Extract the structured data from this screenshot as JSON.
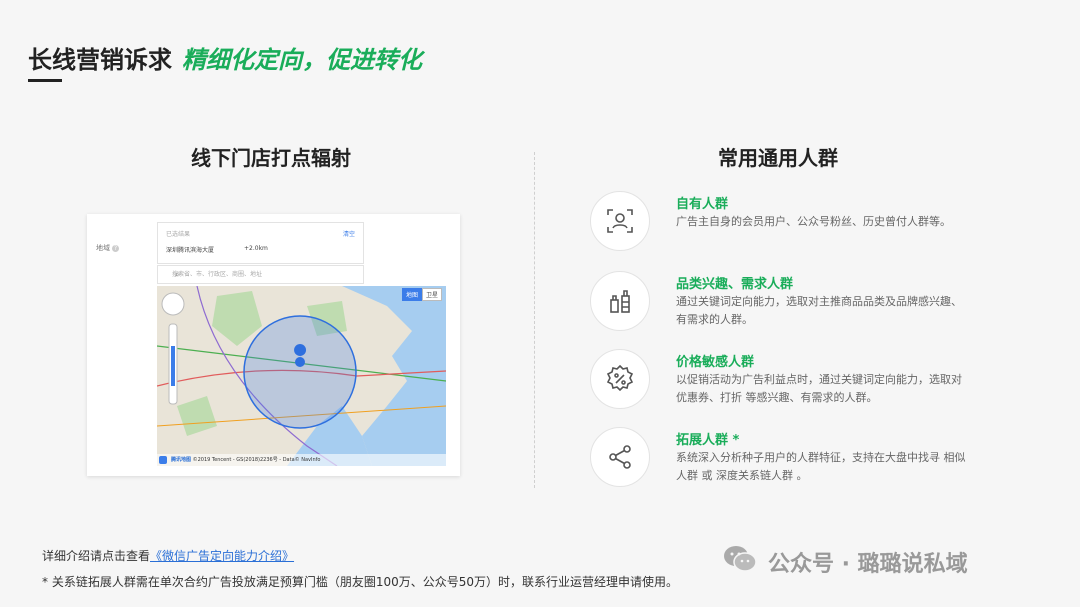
{
  "header": {
    "title": "长线营销诉求",
    "highlight": "精细化定向，促进转化"
  },
  "left": {
    "title": "线下门店打点辐射",
    "map_ui": {
      "field_label": "地域",
      "selected_key": "已选结果",
      "clear_label": "清空",
      "selected_place": "深圳腾讯滨海大厦",
      "radius": "+2.0km",
      "search_placeholder": "搜索省、市、行政区、商圈、地址",
      "map_btn": "地图",
      "sat_btn": "卫星",
      "map_logo": "腾讯地图",
      "attribution": "©2019 Tencent - GS(2018)2236号 - Data© NavInfo"
    }
  },
  "right": {
    "title": "常用通用人群",
    "items": [
      {
        "icon": "user-scan-icon",
        "title": "自有人群",
        "desc": "广告主自身的会员用户、公众号粉丝、历史曾付人群等。"
      },
      {
        "icon": "bottle-products-icon",
        "title": "品类兴趣、需求人群",
        "desc": "通过关键词定向能力，选取对主推商品品类及品牌感兴趣、有需求的人群。"
      },
      {
        "icon": "percent-badge-icon",
        "title": "价格敏感人群",
        "desc": "以促销活动为广告利益点时，通过关键词定向能力，选取对 优惠券、打折 等感兴趣、有需求的人群。"
      },
      {
        "icon": "share-icon",
        "title": "拓展人群 *",
        "desc": "系统深入分析种子用户的人群特征，支持在大盘中找寻 相似人群 或 深度关系链人群 。"
      }
    ]
  },
  "footer": {
    "intro_prefix": "详细介绍请点击查看",
    "intro_link": "《微信广告定向能力介绍》",
    "note": "* 关系链拓展人群需在单次合约广告投放满足预算门槛（朋友圈100万、公众号50万）时，联系行业运营经理申请使用。"
  },
  "watermark": "公众号 · 璐璐说私域",
  "colors": {
    "accent": "#1aad5a",
    "link": "#2a6fd6"
  }
}
